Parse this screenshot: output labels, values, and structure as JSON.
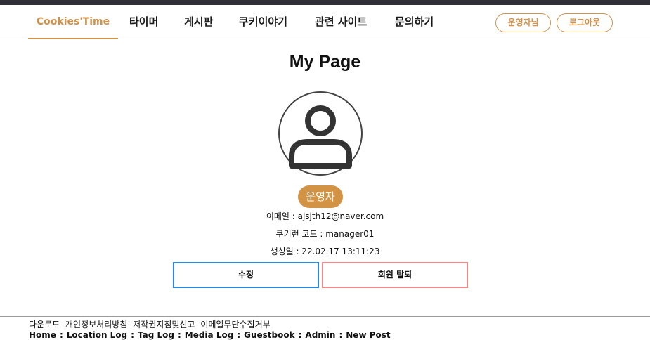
{
  "nav": {
    "brand": "Cookies'Time",
    "items": [
      "타이머",
      "게시판",
      "쿠키이야기",
      "관련 사이트",
      "문의하기"
    ],
    "admin_button": "운영자님",
    "logout_button": "로그아웃"
  },
  "profile": {
    "page_title": "My Page",
    "role": "운영자",
    "email": "이메일 : ajsjth12@naver.com",
    "cookie_code": "쿠키런 코드 : manager01",
    "created": "생성일 : 22.02.17 13:11:23"
  },
  "actions": {
    "edit": "수정",
    "withdraw": "회원 탈퇴"
  },
  "footer": {
    "links": [
      "다운로드",
      "개인정보처리방침",
      "저작권지침및신고",
      "이메일무단수집거부"
    ],
    "nav": [
      "Home",
      "Location Log",
      "Tag Log",
      "Media Log",
      "Guestbook",
      "Admin",
      "New Post"
    ]
  },
  "colors": {
    "accent": "#d3924a",
    "edit_border": "#2d87da",
    "withdraw_border": "#ef8a8a",
    "topbar": "#2f2f35"
  }
}
